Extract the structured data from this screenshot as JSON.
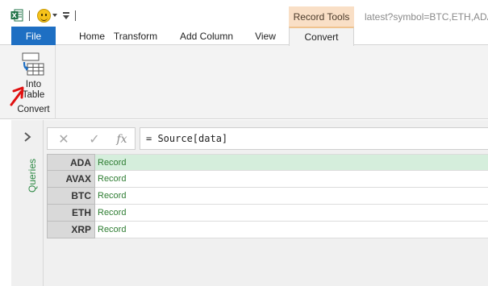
{
  "titlebar": {
    "excel_icon": "excel-app-icon",
    "smiley_icon": "smiley-feedback-icon",
    "context_tab_header": "Record Tools",
    "window_title": "latest?symbol=BTC,ETH,ADA"
  },
  "tabs": [
    {
      "label": "File"
    },
    {
      "label": "Home"
    },
    {
      "label": "Transform"
    },
    {
      "label": "Add Column"
    },
    {
      "label": "View"
    },
    {
      "label": "Convert"
    }
  ],
  "ribbon": {
    "into_table": {
      "line1": "Into",
      "line2": "Table",
      "icon": "into-table-icon"
    },
    "group_label": "Convert"
  },
  "sidebar": {
    "label": "Queries",
    "expand_icon": "chevron-right-icon"
  },
  "formula_bar": {
    "cancel_glyph": "✕",
    "check_glyph": "✓",
    "fx_glyph": "fx",
    "formula": "= Source[data]"
  },
  "grid": {
    "rows": [
      {
        "key": "ADA",
        "value": "Record"
      },
      {
        "key": "AVAX",
        "value": "Record"
      },
      {
        "key": "BTC",
        "value": "Record"
      },
      {
        "key": "ETH",
        "value": "Record"
      },
      {
        "key": "XRP",
        "value": "Record"
      }
    ],
    "selected_index": 0
  },
  "colors": {
    "file_tab": "#1e6fc3",
    "context_tab": "#f9dfc6",
    "record_text": "#2e7d32",
    "selected_row": "#d5eedc",
    "queries_label": "#2f8a46",
    "annotation_arrow": "#e01010"
  }
}
